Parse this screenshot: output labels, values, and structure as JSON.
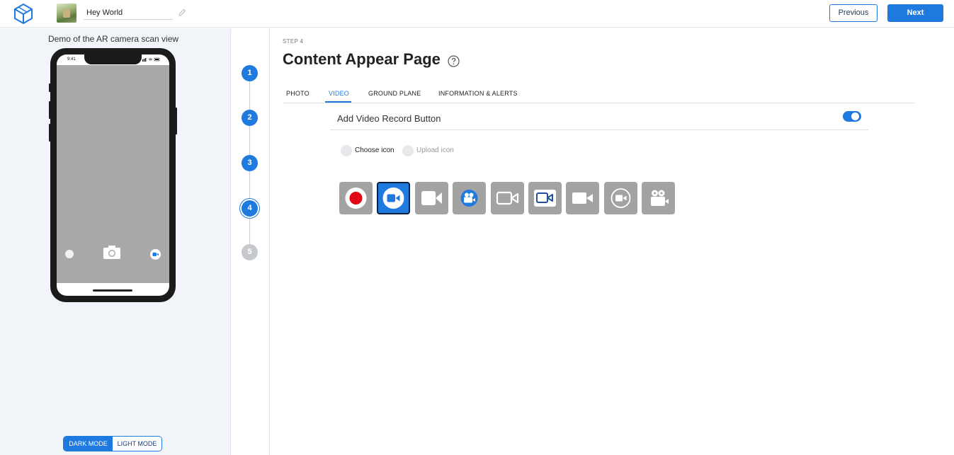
{
  "header": {
    "project_name": "Hey World",
    "previous_label": "Previous",
    "next_label": "Next"
  },
  "preview": {
    "title": "Demo of the AR camera scan view",
    "status_time": "9:41",
    "dark_mode_label": "DARK MODE",
    "light_mode_label": "LIGHT MODE",
    "selected_mode": "DARK MODE"
  },
  "stepper": {
    "steps": [
      {
        "label": "1",
        "state": "done"
      },
      {
        "label": "2",
        "state": "done"
      },
      {
        "label": "3",
        "state": "done"
      },
      {
        "label": "4",
        "state": "active"
      },
      {
        "label": "5",
        "state": "inactive"
      }
    ]
  },
  "content": {
    "step_label": "STEP 4",
    "title": "Content Appear Page",
    "tabs": [
      "PHOTO",
      "VIDEO",
      "GROUND PLANE",
      "INFORMATION & ALERTS"
    ],
    "active_tab": "VIDEO",
    "record_button_label": "Add Video Record Button",
    "record_button_enabled": true,
    "choose_icon_label": "Choose icon",
    "upload_icon_label": "Upload icon",
    "icons": [
      {
        "name": "record-dot-icon",
        "selected": false
      },
      {
        "name": "video-circle-icon",
        "selected": true
      },
      {
        "name": "video-camera-solid-icon",
        "selected": false
      },
      {
        "name": "movie-camera-badge-icon",
        "selected": false
      },
      {
        "name": "video-camera-outline-icon",
        "selected": false
      },
      {
        "name": "video-camera-blue-outline-icon",
        "selected": false
      },
      {
        "name": "video-camera-solid-2-icon",
        "selected": false
      },
      {
        "name": "video-circle-outline-icon",
        "selected": false
      },
      {
        "name": "movie-camera-icon",
        "selected": false
      }
    ]
  },
  "colors": {
    "accent": "#1f7ae0",
    "tile_gray": "#a3a3a3",
    "record_red": "#e30613"
  }
}
